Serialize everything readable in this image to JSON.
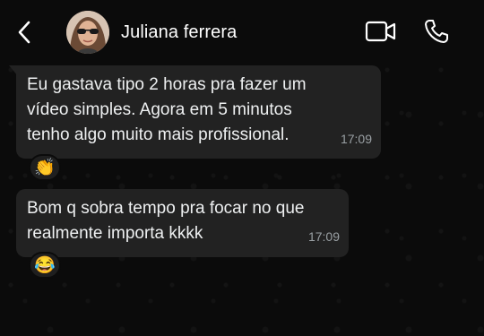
{
  "header": {
    "contact_name": "Juliana ferrera",
    "back_icon": "chevron-left-icon",
    "video_icon": "video-camera-icon",
    "call_icon": "phone-icon"
  },
  "messages": [
    {
      "text": "Eu gastava tipo 2 horas pra fazer um\nvídeo simples. Agora em 5 minutos\ntenho algo muito mais profissional.",
      "time": "17:09",
      "reaction": "👏"
    },
    {
      "text": "Bom q sobra tempo pra focar no que\nrealmente importa kkkk",
      "time": "17:09",
      "reaction": "😂"
    }
  ],
  "colors": {
    "background": "#0b0b0b",
    "bubble": "#222222",
    "text": "#eef0f1",
    "timestamp": "#9aa0a4"
  }
}
